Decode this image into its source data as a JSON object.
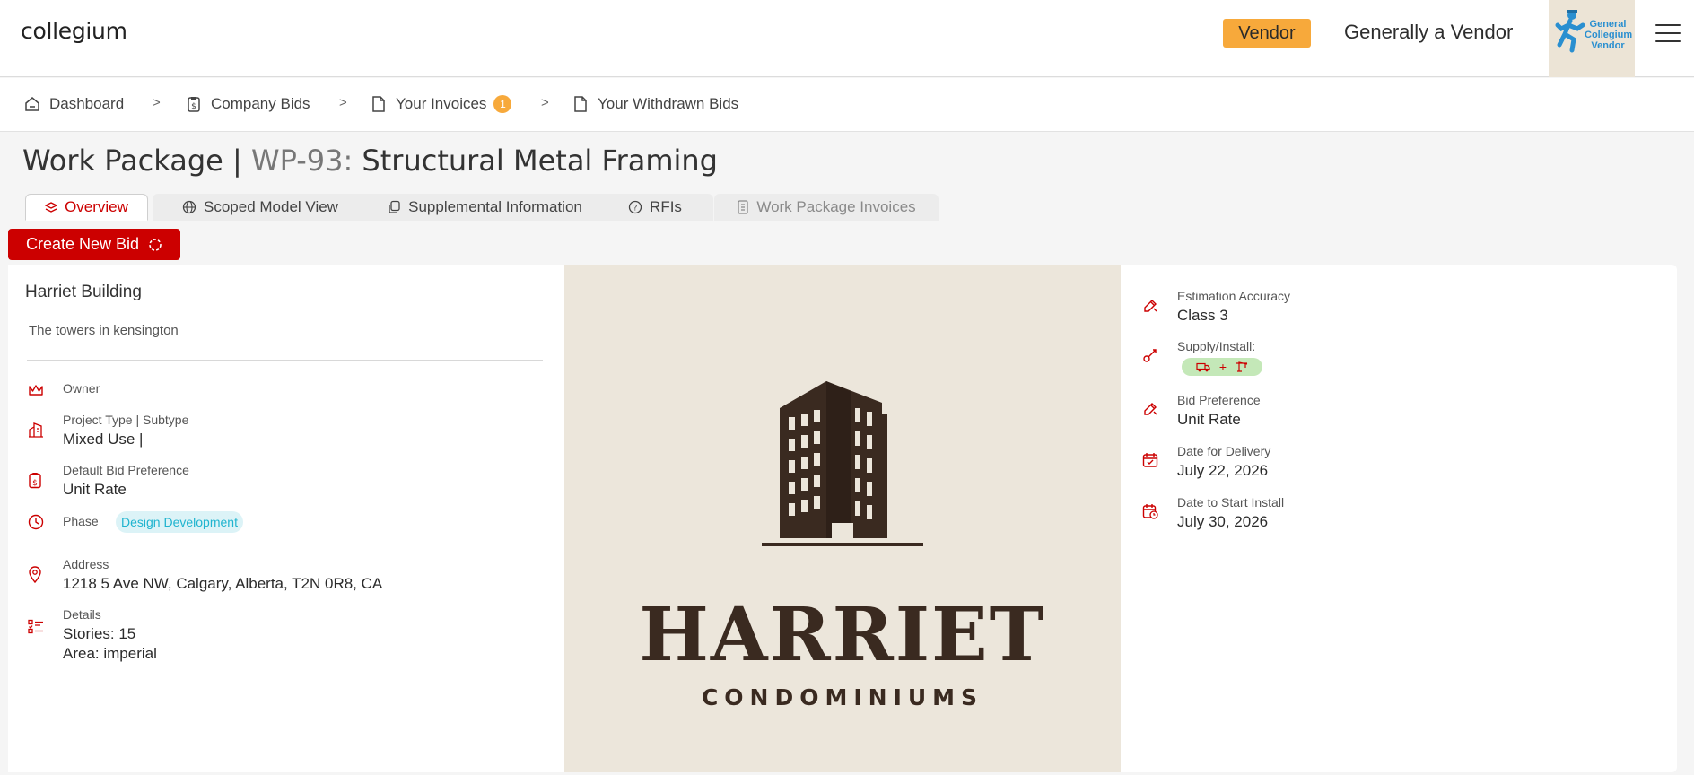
{
  "app": {
    "logo": "collegium"
  },
  "header": {
    "role_badge": "Vendor",
    "user_name": "Generally a Vendor",
    "vendor_logo_text": "General Collegium Vendor",
    "colors": {
      "role_badge": "#f7a93b",
      "logo_accent": "#2a8fd0"
    }
  },
  "breadcrumb": {
    "items": [
      {
        "label": "Dashboard",
        "icon": "home-icon"
      },
      {
        "label": "Company Bids",
        "icon": "dollar-document-icon"
      },
      {
        "label": "Your Invoices",
        "icon": "file-icon",
        "badge": "1"
      },
      {
        "label": "Your Withdrawn Bids",
        "icon": "file-icon"
      }
    ],
    "separator": ">"
  },
  "page": {
    "title_prefix": "Work Package | ",
    "wp_id": "WP-93:",
    "title": "Structural Metal Framing"
  },
  "tabs": [
    {
      "label": "Overview",
      "icon": "layers-icon",
      "active": true
    },
    {
      "label": "Scoped Model View",
      "icon": "globe-icon"
    },
    {
      "label": "Supplemental Information",
      "icon": "copy-icon"
    },
    {
      "label": "RFIs",
      "icon": "question-circle-icon"
    },
    {
      "label": "Work Package Invoices",
      "icon": "invoice-icon",
      "disabled": true
    }
  ],
  "actions": {
    "create_bid": "Create New Bid"
  },
  "project": {
    "name": "Harriet Building",
    "description": "The towers in kensington",
    "owner_label": "Owner",
    "type_label": "Project Type | Subtype",
    "type_value": "Mixed Use |",
    "bid_pref_label": "Default Bid Preference",
    "bid_pref_value": "Unit Rate",
    "phase_label": "Phase",
    "phase_value": "Design Development",
    "address_label": "Address",
    "address_value": "1218 5 Ave NW, Calgary, Alberta, T2N 0R8, CA",
    "details_label": "Details",
    "details_stories": "Stories: 15",
    "details_area": "Area: imperial"
  },
  "project_image": {
    "brand_name": "HARRIET",
    "brand_sub": "CONDOMINIUMS",
    "colors": {
      "background": "#ece6db",
      "ink": "#3a2a20"
    }
  },
  "work_package": {
    "estimation_label": "Estimation Accuracy",
    "estimation_value": "Class 3",
    "supply_label": "Supply/Install:",
    "supply_value": "+",
    "bid_pref_label": "Bid Preference",
    "bid_pref_value": "Unit Rate",
    "delivery_label": "Date for Delivery",
    "delivery_value": "July 22, 2026",
    "install_label": "Date to Start Install",
    "install_value": "July 30, 2026"
  },
  "colors": {
    "accent": "#cc0000",
    "phase_chip_bg": "#dcf3f7",
    "phase_chip_text": "#20b4cf",
    "supply_chip_bg": "#c4e8b8"
  }
}
